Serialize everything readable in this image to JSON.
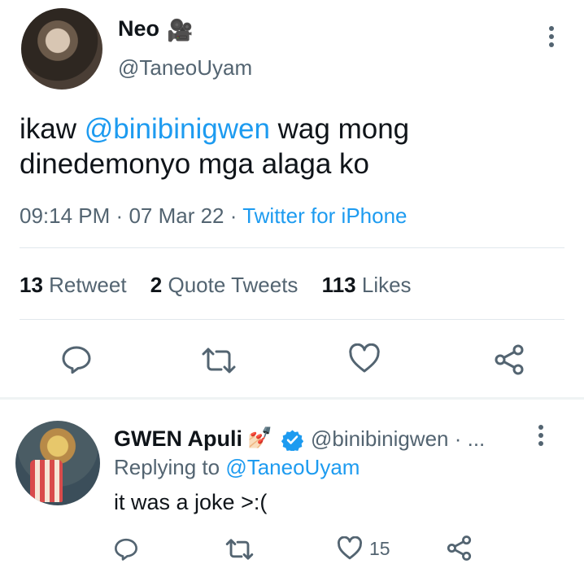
{
  "tweet": {
    "author_name": "Neo",
    "author_emoji": "🎥",
    "author_handle": "@TaneoUyam",
    "text_before": "ikaw ",
    "mention": "@binibinigwen",
    "text_after": " wag mong dinedemonyo mga alaga ko",
    "time": "09:14 PM",
    "date": "07 Mar 22",
    "source": "Twitter for iPhone",
    "stats": {
      "retweets_count": "13",
      "retweets_label": "Retweet",
      "quotes_count": "2",
      "quotes_label": "Quote Tweets",
      "likes_count": "113",
      "likes_label": "Likes"
    },
    "icons": [
      "reply-icon",
      "retweet-icon",
      "like-icon",
      "share-icon",
      "more-icon"
    ]
  },
  "reply": {
    "author_name": "GWEN Apuli",
    "author_emoji": "💅🏻",
    "author_handle": "@binibinigwen",
    "handle_suffix": " · ...",
    "replying_label": "Replying to ",
    "replying_to": "@TaneoUyam",
    "text": "it was a joke >:(",
    "like_count": "15"
  },
  "colors": {
    "accent": "#1d9bf0",
    "secondary_text": "#536471",
    "primary_text": "#0f1419",
    "divider": "#e1e8ed"
  }
}
